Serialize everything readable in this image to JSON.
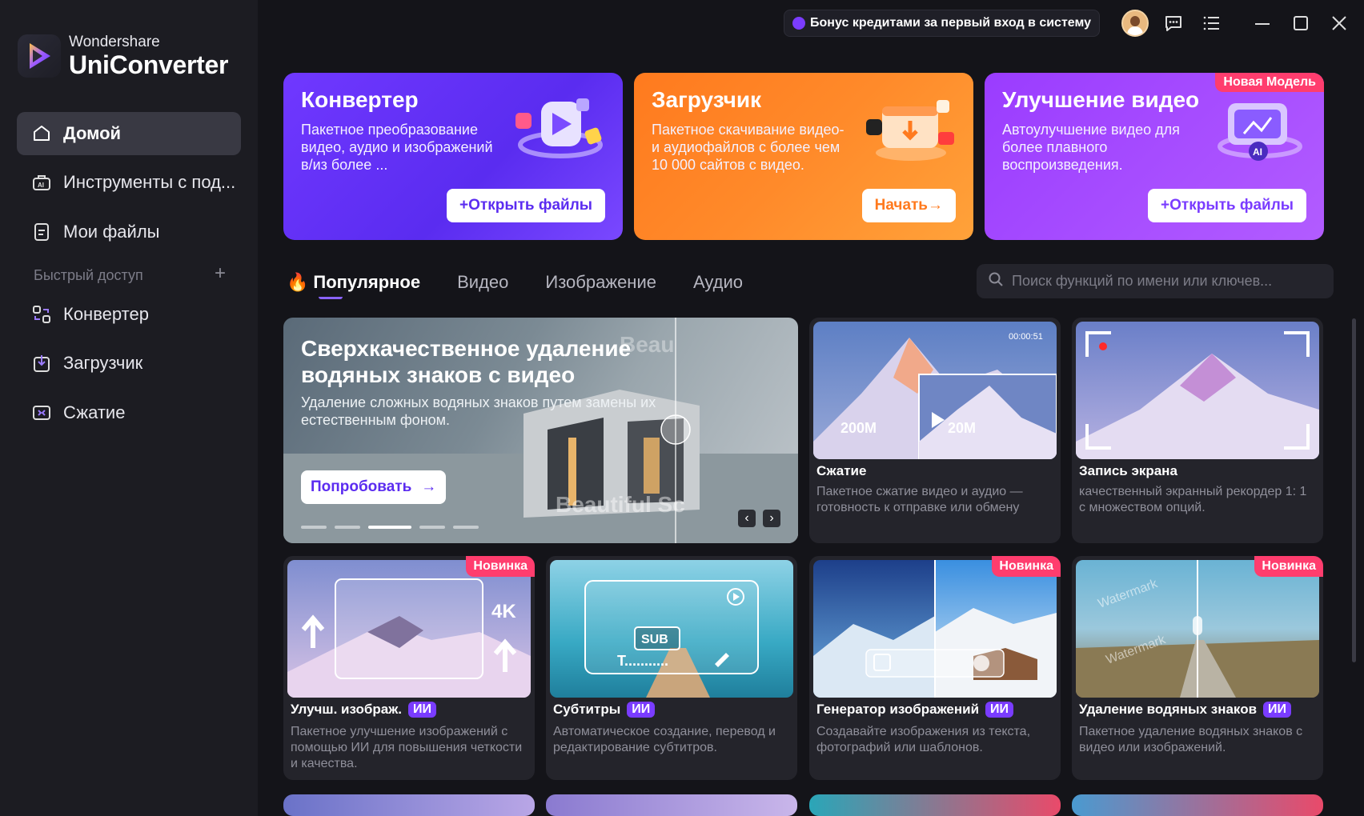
{
  "window": {
    "bonus_text": "Бонус кредитами за первый вход в систему"
  },
  "logo": {
    "brand": "Wondershare",
    "product": "UniConverter"
  },
  "sidebar": {
    "items": [
      {
        "label": "Домой"
      },
      {
        "label": "Инструменты с под..."
      },
      {
        "label": "Мои файлы"
      }
    ],
    "quick_access_label": "Быстрый доступ",
    "quick_items": [
      {
        "label": "Конвертер"
      },
      {
        "label": "Загрузчик"
      },
      {
        "label": "Сжатие"
      }
    ]
  },
  "hero_cards": [
    {
      "title": "Конвертер",
      "desc": "Пакетное преобразование видео, аудио и изображений в/из более ...",
      "button": "+Открыть файлы"
    },
    {
      "title": "Загрузчик",
      "desc": "Пакетное скачивание видео- и аудиофайлов с более чем 10 000 сайтов с видео.",
      "button": "Начать→"
    },
    {
      "title": "Улучшение видео",
      "desc": "Автоулучшение видео для более плавного воспроизведения.",
      "button": "+Открыть файлы",
      "badge": "Новая Модель"
    }
  ],
  "tabs": [
    {
      "label": "Популярное"
    },
    {
      "label": "Видео"
    },
    {
      "label": "Изображение"
    },
    {
      "label": "Аудио"
    }
  ],
  "search": {
    "placeholder": "Поиск функций по имени или ключев..."
  },
  "banner": {
    "title": "Сверхкачественное удаление водяных знаков с видео",
    "desc": "Удаление сложных водяных знаков путем замены их естественным фоном.",
    "button": "Попробовать",
    "watermark_text": "Beautiful Sc",
    "watermark_top": "Beau"
  },
  "tools_top": [
    {
      "title": "Сжатие",
      "desc": "Пакетное сжатие видео и аудио — готовность к отправке или обмену",
      "timestamp": "00:00:51",
      "size_from": "200M",
      "size_to": "20M"
    },
    {
      "title": "Запись экрана",
      "desc": "качественный экранный рекордер 1: 1 с множеством опций."
    }
  ],
  "tools": [
    {
      "title": "Улучш. изображ.",
      "ai": "ИИ",
      "badge": "Новинка",
      "desc": "Пакетное улучшение изображений с помощью ИИ для повышения четкости и качества.",
      "res": "4K"
    },
    {
      "title": "Субтитры",
      "ai": "ИИ",
      "desc": "Автоматическое создание, перевод и редактирование субтитров.",
      "sub": "SUB",
      "sub_text": "T..........."
    },
    {
      "title": "Генератор изображений",
      "ai": "ИИ",
      "badge": "Новинка",
      "desc": "Создавайте изображения из текста, фотографий или шаблонов."
    },
    {
      "title": "Удаление водяных знаков",
      "ai": "ИИ",
      "badge": "Новинка",
      "desc": "Пакетное удаление водяных знаков с видео или изображений.",
      "wm": "Watermark"
    }
  ]
}
